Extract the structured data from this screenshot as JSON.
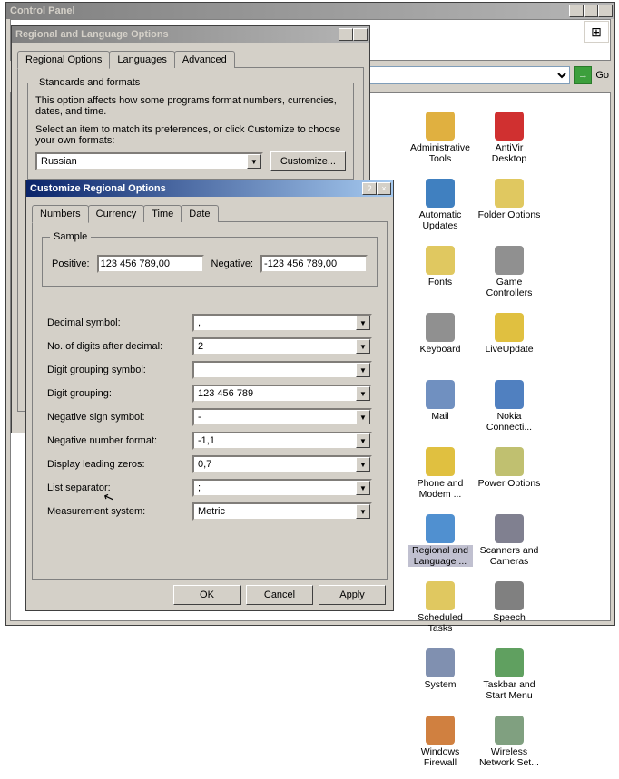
{
  "cp": {
    "title": "Control Panel",
    "go": "Go",
    "items": [
      {
        "label": "Administrative Tools",
        "color": "#e0b040"
      },
      {
        "label": "AntiVir Desktop",
        "color": "#d03030"
      },
      {
        "label": "Automatic Updates",
        "color": "#4080c0"
      },
      {
        "label": "Folder Options",
        "color": "#e0c860"
      },
      {
        "label": "Fonts",
        "color": "#e0c860"
      },
      {
        "label": "Game Controllers",
        "color": "#909090"
      },
      {
        "label": "Keyboard",
        "color": "#909090"
      },
      {
        "label": "LiveUpdate",
        "color": "#e0c040"
      },
      {
        "label": "Mail",
        "color": "#7090c0"
      },
      {
        "label": "Nokia Connecti...",
        "color": "#5080c0"
      },
      {
        "label": "Phone and Modem ...",
        "color": "#e0c040"
      },
      {
        "label": "Power Options",
        "color": "#c0c070"
      },
      {
        "label": "Regional and Language ...",
        "color": "#5090d0",
        "selected": true
      },
      {
        "label": "Scanners and Cameras",
        "color": "#808090"
      },
      {
        "label": "Scheduled Tasks",
        "color": "#e0c860"
      },
      {
        "label": "Speech",
        "color": "#808080"
      },
      {
        "label": "System",
        "color": "#8090b0"
      },
      {
        "label": "Taskbar and Start Menu",
        "color": "#60a060"
      },
      {
        "label": "Windows Firewall",
        "color": "#d08040"
      },
      {
        "label": "Wireless Network Set...",
        "color": "#80a080"
      }
    ]
  },
  "reg": {
    "title": "Regional and Language Options",
    "tabs": [
      "Regional Options",
      "Languages",
      "Advanced"
    ],
    "groupTitle": "Standards and formats",
    "desc1": "This option affects how some programs format numbers, currencies, dates, and time.",
    "desc2": "Select an item to match its preferences, or click Customize to choose your own formats:",
    "locale": "Russian",
    "customize": "Customize..."
  },
  "cust": {
    "title": "Customize Regional Options",
    "tabs": [
      "Numbers",
      "Currency",
      "Time",
      "Date"
    ],
    "sample": "Sample",
    "posLabel": "Positive:",
    "posVal": "123 456 789,00",
    "negLabel": "Negative:",
    "negVal": "-123 456 789,00",
    "fields": {
      "decimal": {
        "label": "Decimal symbol:",
        "value": ","
      },
      "digits": {
        "label": "No. of digits after decimal:",
        "value": "2"
      },
      "groupSym": {
        "label": "Digit grouping symbol:",
        "value": ""
      },
      "grouping": {
        "label": "Digit grouping:",
        "value": "123 456 789"
      },
      "negSign": {
        "label": "Negative sign symbol:",
        "value": "-"
      },
      "negFmt": {
        "label": "Negative number format:",
        "value": "-1,1"
      },
      "leadZero": {
        "label": "Display leading zeros:",
        "value": "0,7"
      },
      "listSep": {
        "label": "List separator:",
        "value": ";"
      },
      "measure": {
        "label": "Measurement system:",
        "value": "Metric"
      }
    },
    "ok": "OK",
    "cancel": "Cancel",
    "apply": "Apply"
  }
}
